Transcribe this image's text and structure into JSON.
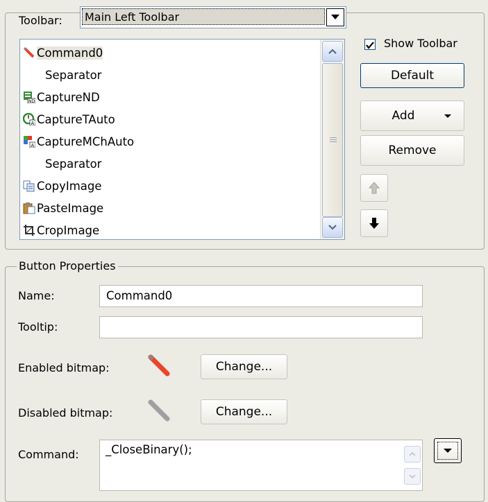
{
  "toolbar_section": {
    "label": "Toolbar:",
    "selected": "Main Left Toolbar",
    "show_toolbar_label": "Show Toolbar",
    "show_toolbar_checked": true
  },
  "commands": [
    {
      "label": "Command0",
      "icon": "pencil-icon",
      "selected": true
    },
    {
      "label": "Separator",
      "icon": ""
    },
    {
      "label": "CaptureND",
      "icon": "capture-nd-icon"
    },
    {
      "label": "CaptureTAuto",
      "icon": "capture-timer-icon"
    },
    {
      "label": "CaptureMChAuto",
      "icon": "capture-multichannel-icon"
    },
    {
      "label": "Separator",
      "icon": ""
    },
    {
      "label": "CopyImage",
      "icon": "copy-icon"
    },
    {
      "label": "PasteImage",
      "icon": "paste-icon"
    },
    {
      "label": "CropImage",
      "icon": "crop-icon"
    }
  ],
  "buttons": {
    "default": "Default",
    "add": "Add",
    "remove": "Remove",
    "move_up_icon": "arrow-up-icon",
    "move_down_icon": "arrow-down-icon"
  },
  "properties": {
    "legend": "Button Properties",
    "name_label": "Name:",
    "name_value": "Command0",
    "tooltip_label": "Tooltip:",
    "tooltip_value": "",
    "enabled_label": "Enabled bitmap:",
    "disabled_label": "Disabled bitmap:",
    "change_label": "Change...",
    "command_label": "Command:",
    "command_value": "_CloseBinary();"
  },
  "colors": {
    "background": "#ecebe4",
    "enabled_bitmap": "#e8452a",
    "disabled_bitmap": "#a0a0a0",
    "button_border": "#003c74"
  }
}
